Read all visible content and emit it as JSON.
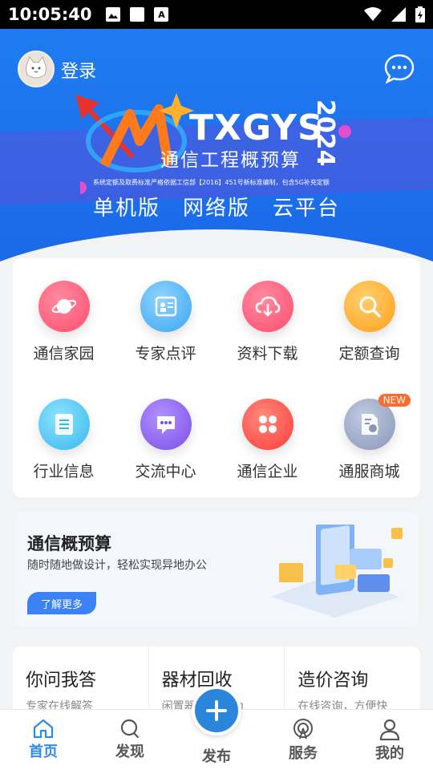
{
  "status_bar": {
    "time": "10:05:40",
    "left_icons": [
      "image-icon",
      "square-icon",
      "a-icon"
    ],
    "right_icons": [
      "wifi-icon",
      "signal-icon",
      "battery-icon"
    ]
  },
  "header": {
    "login_label": "登录",
    "chat_icon": "chat-bubble-icon"
  },
  "banner": {
    "brand_title": "TXGYS",
    "brand_year": "2024",
    "brand_subtitle": "通信工程概预算",
    "note": "系统定额及取费标准严格依据工信部【2016】451号新标准编制，包含5G补充定额",
    "versions": [
      "单机版",
      "网络版",
      "云平台"
    ]
  },
  "grid": {
    "items": [
      {
        "label": "通信家园",
        "icon": "planet-icon",
        "color": "#ff5d7a"
      },
      {
        "label": "专家点评",
        "icon": "expert-card-icon",
        "color": "#4fb3f7"
      },
      {
        "label": "资料下载",
        "icon": "cloud-download-icon",
        "color": "#ff5d7a"
      },
      {
        "label": "定额查询",
        "icon": "search-icon",
        "color": "#ffae2e"
      },
      {
        "label": "行业信息",
        "icon": "document-icon",
        "color": "#4fc6f0"
      },
      {
        "label": "交流中心",
        "icon": "chat-dots-icon",
        "color": "#8b63ef"
      },
      {
        "label": "通信企业",
        "icon": "clover-icon",
        "color": "#ff5252"
      },
      {
        "label": "通服商城",
        "icon": "shop-doc-icon",
        "color": "#95a4c6",
        "badge": "NEW"
      }
    ]
  },
  "promo": {
    "title": "通信概预算",
    "description": "随时随地做设计，轻松实现异地办公",
    "button": "了解更多"
  },
  "qa": {
    "columns": [
      {
        "title": "你问我答",
        "subtitle": "专家在线解答"
      },
      {
        "title": "器材回收",
        "subtitle": "闲置器材 变废为"
      },
      {
        "title": "造价咨询",
        "subtitle": "在线咨询，方便快"
      }
    ]
  },
  "bottom_nav": {
    "items": [
      {
        "label": "首页",
        "icon": "home-icon",
        "active": true
      },
      {
        "label": "发现",
        "icon": "discover-icon",
        "active": false
      },
      {
        "label": "发布",
        "icon": "plus-icon",
        "active": false
      },
      {
        "label": "服务",
        "icon": "service-icon",
        "active": false
      },
      {
        "label": "我的",
        "icon": "user-icon",
        "active": false
      }
    ]
  },
  "colors": {
    "primary_blue": "#1f7cf0",
    "active_nav": "#2e8ae6",
    "badge": "#ff6a2a"
  }
}
